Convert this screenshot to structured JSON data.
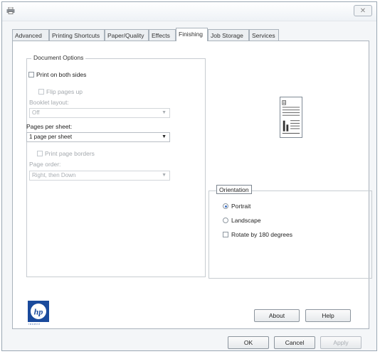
{
  "window": {
    "printer_icon": "printer-icon",
    "close_glyph": "✕"
  },
  "tabs": [
    {
      "label": "Advanced"
    },
    {
      "label": "Printing Shortcuts"
    },
    {
      "label": "Paper/Quality"
    },
    {
      "label": "Effects"
    },
    {
      "label": "Finishing",
      "active": true
    },
    {
      "label": "Job Storage"
    },
    {
      "label": "Services"
    }
  ],
  "document_options": {
    "title": "Document Options",
    "print_both_sides": "Print on both sides",
    "print_both_sides_checked": false,
    "flip_pages_up": "Flip pages up",
    "booklet_layout_label": "Booklet layout:",
    "booklet_layout_value": "Off",
    "pages_per_sheet_label": "Pages per sheet:",
    "pages_per_sheet_value": "1 page per sheet",
    "print_page_borders": "Print page borders",
    "page_order_label": "Page order:",
    "page_order_value": "Right, then Down"
  },
  "orientation": {
    "title": "Orientation",
    "portrait": "Portrait",
    "landscape": "Landscape",
    "selected": "portrait",
    "rotate_180": "Rotate by 180 degrees",
    "rotate_checked": false
  },
  "branding": {
    "logo_text": "hp",
    "tagline": "invent"
  },
  "buttons": {
    "about": "About",
    "help": "Help",
    "ok": "OK",
    "cancel": "Cancel",
    "apply": "Apply"
  },
  "colors": {
    "hp_blue": "#1a4a9c",
    "radio_selected": "#3c6fc4"
  }
}
